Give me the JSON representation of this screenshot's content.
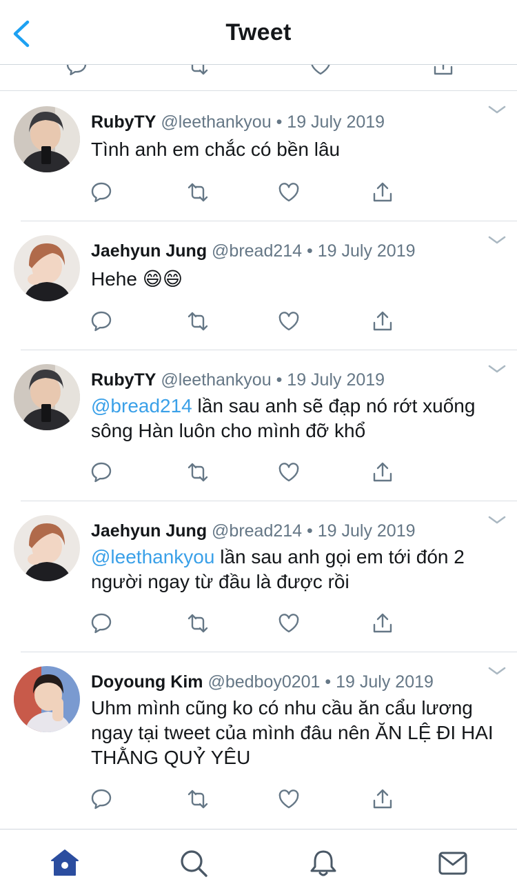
{
  "header": {
    "title": "Tweet",
    "back_icon": "chevron-left-icon",
    "accent": "#1da1f2"
  },
  "colors": {
    "mention": "#3aa0e8",
    "secondary": "#657786",
    "home_active": "#2b4d9f"
  },
  "tweets": [
    {
      "name": "RubyTY",
      "handle": "@leethankyou",
      "date": "19 July 2019",
      "text": "Tình anh em chắc có bền lâu",
      "mention": "",
      "text_after": ""
    },
    {
      "name": "Jaehyun Jung",
      "handle": "@bread214",
      "date": "19 July 2019",
      "text": "Hehe 😄😄",
      "mention": "",
      "text_after": ""
    },
    {
      "name": "RubyTY",
      "handle": "@leethankyou",
      "date": "19 July 2019",
      "text": "",
      "mention": "@bread214",
      "text_after": " lần sau anh sẽ đạp nó rớt xuống sông Hàn luôn cho mình đỡ khổ"
    },
    {
      "name": "Jaehyun Jung",
      "handle": "@bread214",
      "date": "19 July 2019",
      "text": "",
      "mention": "@leethankyou",
      "text_after": " lần sau anh gọi em tới đón 2 người ngay từ đầu là được rồi"
    },
    {
      "name": "Doyoung Kim",
      "handle": "@bedboy0201",
      "date": "19 July 2019",
      "text": "Uhm mình cũng ko có nhu cầu ăn cẩu lương ngay tại tweet của mình đâu nên ĂN LỆ ĐI HAI THẰNG QUỶ YÊU",
      "mention": "",
      "text_after": ""
    }
  ],
  "tweet_actions": [
    "reply-icon",
    "retweet-icon",
    "like-icon",
    "share-icon"
  ],
  "tabbar": {
    "tabs": [
      "home-icon",
      "search-icon",
      "notifications-icon",
      "messages-icon"
    ],
    "active": "home-icon"
  },
  "dot_separator": "•"
}
